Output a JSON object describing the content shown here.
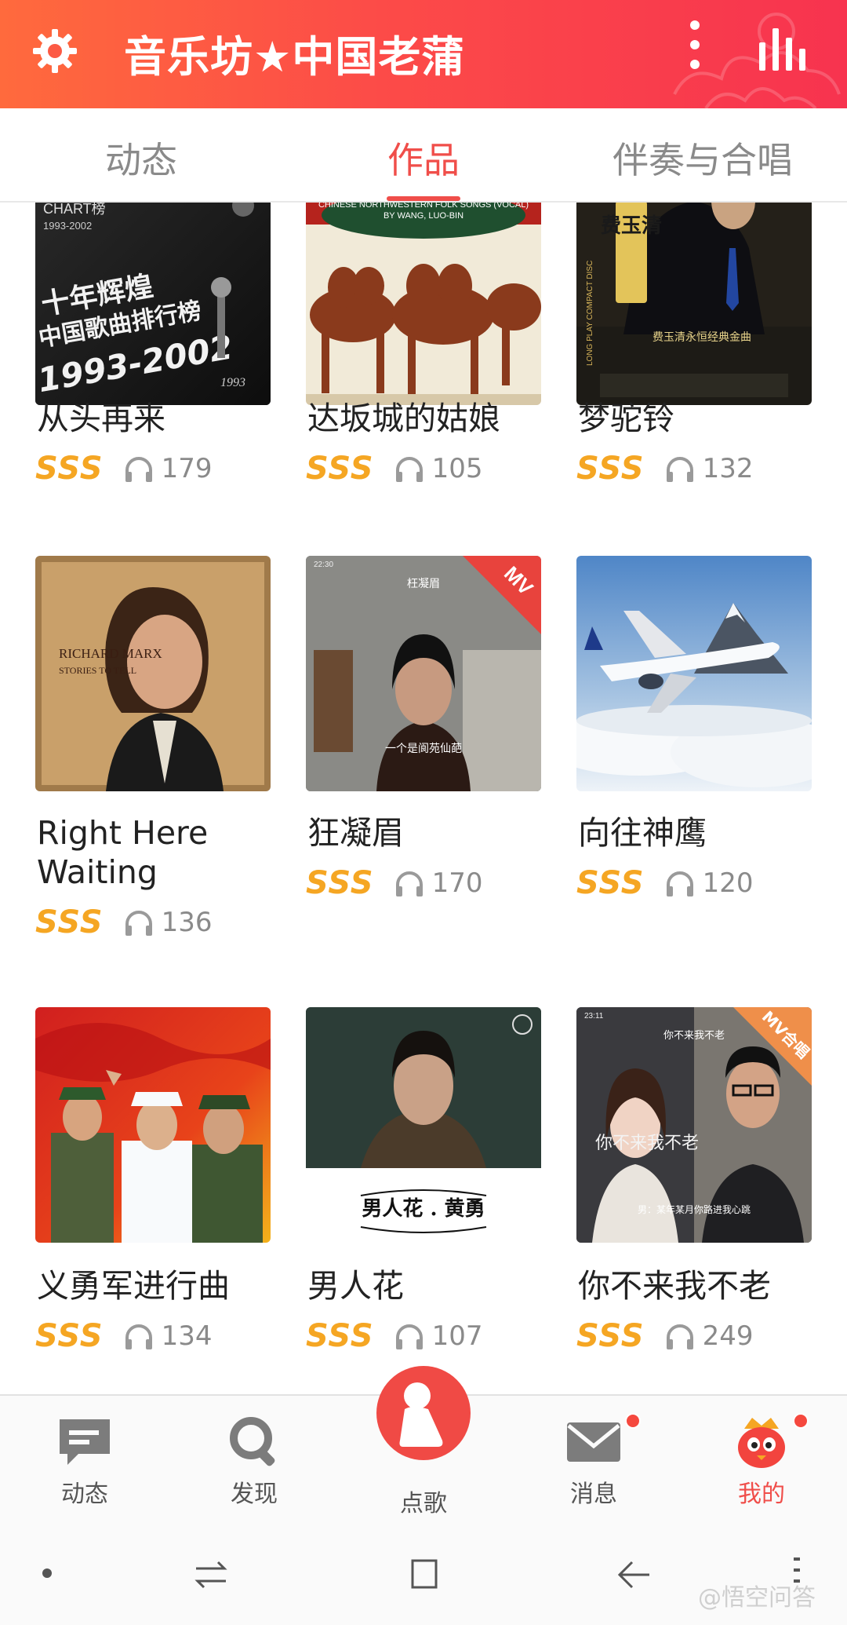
{
  "header": {
    "title": "音乐坊★中国老蒲",
    "icons": [
      "gear-icon",
      "more-vertical-icon",
      "equalizer-icon"
    ]
  },
  "tabs": [
    {
      "label": "动态",
      "active": false
    },
    {
      "label": "作品",
      "active": true
    },
    {
      "label": "伴奏与合唱",
      "active": false
    }
  ],
  "songs": [
    {
      "title": "从头再来",
      "grade": "SSS",
      "plays": "179",
      "cover_text": [
        "CHART榜",
        "1993-2002",
        "十年辉煌",
        "中国歌曲排行榜",
        "1993-2002",
        "1993"
      ]
    },
    {
      "title": "达坂城的姑娘",
      "grade": "SSS",
      "plays": "105",
      "cover_text": [
        "CHINESE NORTHWESTERN FOLK SONGS (VOCAL)",
        "BY WANG, LUO-BIN"
      ]
    },
    {
      "title": "梦驼铃",
      "grade": "SSS",
      "plays": "132",
      "cover_text": [
        "费玉清",
        "费玉清永恒经典金曲",
        "LONG PLAY COMPACT DISC"
      ]
    },
    {
      "title": "Right Here Waiting",
      "grade": "SSS",
      "plays": "136",
      "cover_text": [
        "RICHARD MARX",
        "STORIES TO TELL"
      ]
    },
    {
      "title": "狂凝眉",
      "grade": "SSS",
      "plays": "170",
      "cover_text": [
        "22:30",
        "枉凝眉",
        "一个是阆苑仙葩"
      ],
      "badge": "MV"
    },
    {
      "title": "向往神鹰",
      "grade": "SSS",
      "plays": "120",
      "cover_text": []
    },
    {
      "title": "义勇军进行曲",
      "grade": "SSS",
      "plays": "134",
      "cover_text": []
    },
    {
      "title": "男人花",
      "grade": "SSS",
      "plays": "107",
      "cover_text": [
        "男人花 . 黄勇"
      ]
    },
    {
      "title": "你不来我不老",
      "grade": "SSS",
      "plays": "249",
      "cover_text": [
        "23:11",
        "你不来我不老",
        "你不来我不老",
        "男：某年某月你路进我心跳"
      ],
      "badge": "MV合唱"
    }
  ],
  "bottom_nav": [
    {
      "label": "动态",
      "icon": "chat-bubble-icon",
      "active": false
    },
    {
      "label": "发现",
      "icon": "search-icon",
      "active": false
    },
    {
      "label": "点歌",
      "icon": "microphone-icon",
      "active": false
    },
    {
      "label": "消息",
      "icon": "envelope-icon",
      "active": false,
      "badge_dot": true
    },
    {
      "label": "我的",
      "icon": "mascot-icon",
      "active": true,
      "badge_dot": true
    }
  ],
  "system_nav": [
    "dot-icon",
    "recent-apps-icon",
    "home-icon",
    "back-icon",
    "menu-icon"
  ],
  "watermark": "@悟空问答",
  "colors": {
    "accent": "#f04e4a",
    "grade": "#f5a623",
    "header_start": "#ff6a3d",
    "header_end": "#f7334f"
  }
}
